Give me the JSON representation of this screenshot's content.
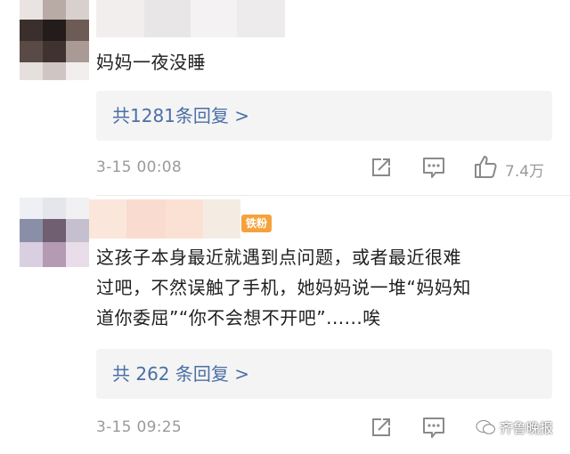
{
  "comments": [
    {
      "text": "妈妈一夜没睡",
      "replies_label": "共1281条回复 >",
      "time": "3-15 00:08",
      "likes": "7.4万"
    },
    {
      "badge": "铁粉",
      "text_lines": [
        "这孩子本身最近就遇到点问题，或者最近很难",
        "过吧，不然误触了手机，她妈妈说一堆“妈妈知",
        "道你委屈”“你不会想不开吧”......唉"
      ],
      "replies_label": "共 262 条回复 >",
      "time": "3-15 09:25"
    }
  ],
  "watermark": "齐鲁晚报",
  "icons": {
    "share": "share-icon",
    "comment": "comment-icon",
    "like": "thumbs-up-icon"
  },
  "colors": {
    "link": "#4a6fa5",
    "badge": "#f6a23c",
    "meta": "#9a9a9a"
  }
}
